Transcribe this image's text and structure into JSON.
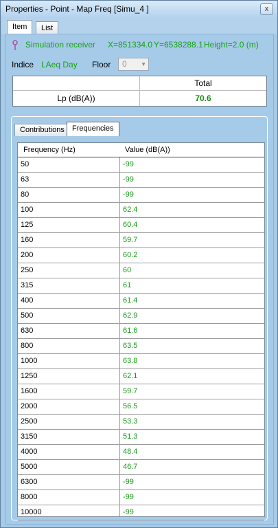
{
  "window": {
    "title": "Properties - Point - Map Freq [Simu_4 ]",
    "close_label": "x"
  },
  "top_tabs": [
    {
      "label": "Item",
      "active": true
    },
    {
      "label": "List",
      "active": false
    }
  ],
  "receiver": {
    "type": "Simulation receiver",
    "x": "X=851334.0",
    "y": "Y=6538288.1",
    "height": "Height=2.0 (m)"
  },
  "indice": {
    "label": "Indice",
    "value": "LAeq Day"
  },
  "floor": {
    "label": "Floor",
    "value": "0"
  },
  "total_table": {
    "column_header": "Total",
    "row_label": "Lp (dB(A))",
    "value": "70.6"
  },
  "sub_tabs": [
    {
      "label": "Contributions",
      "active": false
    },
    {
      "label": "Frequencies",
      "active": true
    }
  ],
  "freq_table": {
    "columns": [
      "Frequency (Hz)",
      "Value (dB(A))"
    ],
    "rows": [
      {
        "freq": "50",
        "value": "-99"
      },
      {
        "freq": "63",
        "value": "-99"
      },
      {
        "freq": "80",
        "value": "-99"
      },
      {
        "freq": "100",
        "value": "62.4"
      },
      {
        "freq": "125",
        "value": "60.4"
      },
      {
        "freq": "160",
        "value": "59.7"
      },
      {
        "freq": "200",
        "value": "60.2"
      },
      {
        "freq": "250",
        "value": "60"
      },
      {
        "freq": "315",
        "value": "61"
      },
      {
        "freq": "400",
        "value": "61.4"
      },
      {
        "freq": "500",
        "value": "62.9"
      },
      {
        "freq": "630",
        "value": "61.6"
      },
      {
        "freq": "800",
        "value": "63.5"
      },
      {
        "freq": "1000",
        "value": "63.8"
      },
      {
        "freq": "1250",
        "value": "62.1"
      },
      {
        "freq": "1600",
        "value": "59.7"
      },
      {
        "freq": "2000",
        "value": "56.5"
      },
      {
        "freq": "2500",
        "value": "53.3"
      },
      {
        "freq": "3150",
        "value": "51.3"
      },
      {
        "freq": "4000",
        "value": "48.4"
      },
      {
        "freq": "5000",
        "value": "46.7"
      },
      {
        "freq": "6300",
        "value": "-99"
      },
      {
        "freq": "8000",
        "value": "-99"
      },
      {
        "freq": "10000",
        "value": "-99"
      }
    ]
  },
  "colors": {
    "value_green": "#1a9a1a",
    "panel_blue": "#a6cbe8"
  }
}
